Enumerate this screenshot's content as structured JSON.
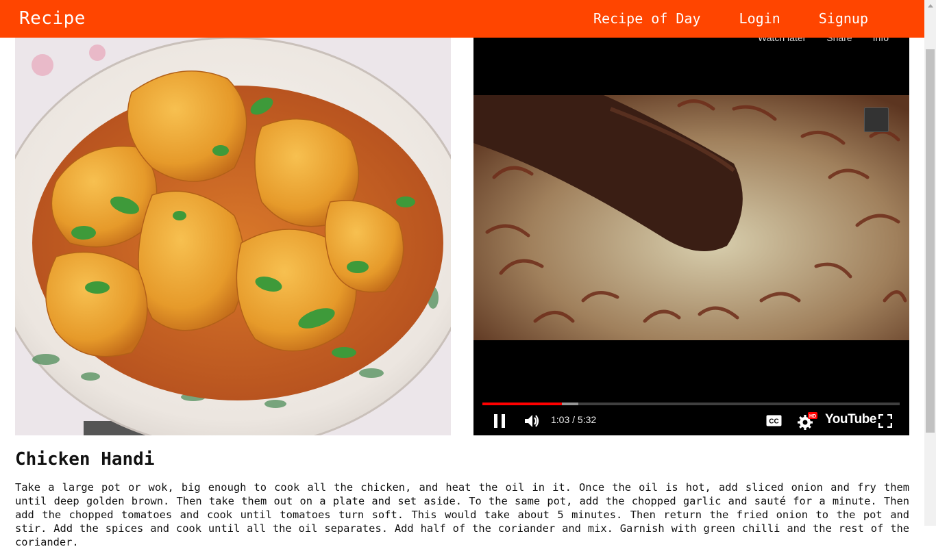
{
  "navbar": {
    "brand": "Recipe",
    "links": [
      "Recipe of Day",
      "Login",
      "Signup"
    ]
  },
  "video": {
    "top_actions": [
      "Watch later",
      "Share",
      "Info"
    ],
    "current_time": "1:03",
    "duration": "5:32",
    "time_display": "1:03 / 5:32",
    "played_fraction": 0.19,
    "buffered_fraction": 0.23,
    "logo": "YouTube",
    "hd_badge": "HD"
  },
  "recipe": {
    "title": "Chicken Handi",
    "description": "Take a large pot or wok, big enough to cook all the chicken, and heat the oil in it. Once the oil is hot, add sliced onion and fry them until deep golden brown. Then take them out on a plate and set aside. To the same pot, add the chopped garlic and sauté for a minute. Then add the chopped tomatoes and cook until tomatoes turn soft. This would take about 5 minutes. Then return the fried onion to the pot and stir. Add the spices and cook until all the oil separates. Add half of the coriander and mix. Garnish with green chilli and the rest of the coriander."
  },
  "colors": {
    "navbar": "#ff4500",
    "progress": "#ff0000"
  }
}
